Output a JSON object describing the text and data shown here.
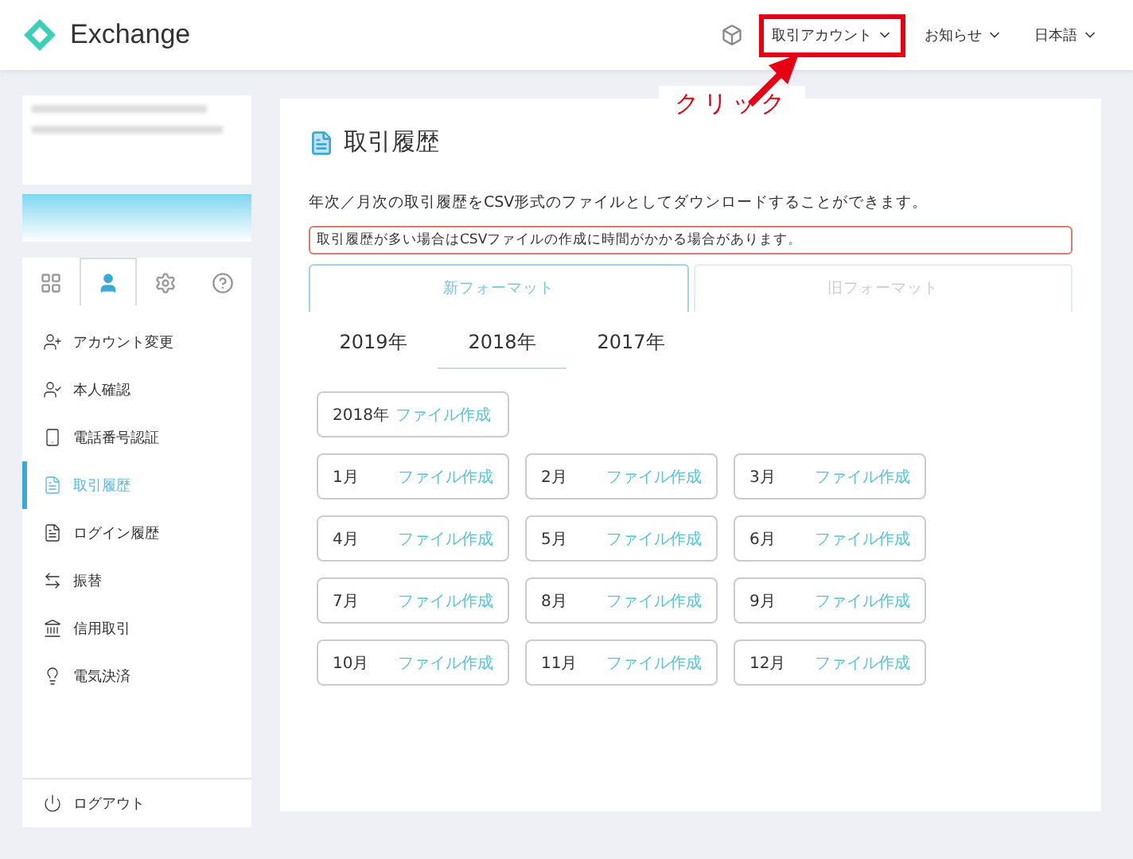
{
  "header": {
    "logo": "Exchange",
    "menus": [
      {
        "label": "取引アカウント",
        "highlighted": true
      },
      {
        "label": "お知らせ",
        "highlighted": false
      },
      {
        "label": "日本語",
        "highlighted": false
      }
    ]
  },
  "annotation": {
    "label": "クリック"
  },
  "sidebar": {
    "tabs": [
      {
        "kind": "grid",
        "selected": false
      },
      {
        "kind": "user",
        "selected": true
      },
      {
        "kind": "gear",
        "selected": false
      },
      {
        "kind": "help",
        "selected": false
      }
    ],
    "items": [
      {
        "label": "アカウント変更",
        "kind": "useradd",
        "selected": false
      },
      {
        "label": "本人確認",
        "kind": "identity",
        "selected": false
      },
      {
        "label": "電話番号認証",
        "kind": "phone",
        "selected": false
      },
      {
        "label": "取引履歴",
        "kind": "document",
        "selected": true
      },
      {
        "label": "ログイン履歴",
        "kind": "document",
        "selected": false
      },
      {
        "label": "振替",
        "kind": "transfer",
        "selected": false
      },
      {
        "label": "信用取引",
        "kind": "bank",
        "selected": false
      },
      {
        "label": "電気決済",
        "kind": "bulb",
        "selected": false
      }
    ],
    "logout": "ログアウト"
  },
  "main": {
    "title": "取引履歴",
    "description": "年次／月次の取引履歴をCSV形式のファイルとしてダウンロードすることができます。",
    "warning": "取引履歴が多い場合はCSVファイルの作成に時間がかかる場合があります。",
    "format_tabs": [
      {
        "label": "新フォーマット",
        "selected": true
      },
      {
        "label": "旧フォーマット",
        "selected": false
      }
    ],
    "years": [
      {
        "label": "2019年",
        "selected": false
      },
      {
        "label": "2018年",
        "selected": true
      },
      {
        "label": "2017年",
        "selected": false
      }
    ],
    "year_file": {
      "label": "2018年",
      "action": "ファイル作成"
    },
    "months": [
      {
        "label": "1月",
        "action": "ファイル作成"
      },
      {
        "label": "2月",
        "action": "ファイル作成"
      },
      {
        "label": "3月",
        "action": "ファイル作成"
      },
      {
        "label": "4月",
        "action": "ファイル作成"
      },
      {
        "label": "5月",
        "action": "ファイル作成"
      },
      {
        "label": "6月",
        "action": "ファイル作成"
      },
      {
        "label": "7月",
        "action": "ファイル作成"
      },
      {
        "label": "8月",
        "action": "ファイル作成"
      },
      {
        "label": "9月",
        "action": "ファイル作成"
      },
      {
        "label": "10月",
        "action": "ファイル作成"
      },
      {
        "label": "11月",
        "action": "ファイル作成"
      },
      {
        "label": "12月",
        "action": "ファイル作成"
      }
    ]
  }
}
